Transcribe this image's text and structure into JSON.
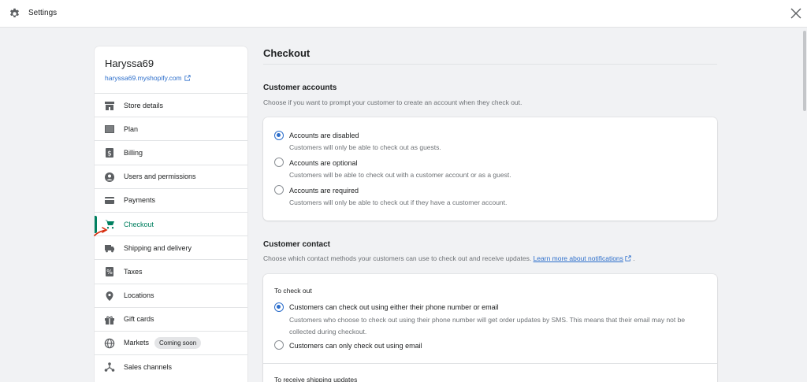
{
  "topbar": {
    "title": "Settings"
  },
  "sidebar": {
    "store_name": "Haryssa69",
    "store_url": "haryssa69.myshopify.com",
    "items": [
      {
        "label": "Store details",
        "icon": "store-icon"
      },
      {
        "label": "Plan",
        "icon": "plan-icon"
      },
      {
        "label": "Billing",
        "icon": "billing-icon"
      },
      {
        "label": "Users and permissions",
        "icon": "user-icon"
      },
      {
        "label": "Payments",
        "icon": "payments-icon"
      },
      {
        "label": "Checkout",
        "icon": "cart-icon",
        "active": true
      },
      {
        "label": "Shipping and delivery",
        "icon": "truck-icon"
      },
      {
        "label": "Taxes",
        "icon": "taxes-icon"
      },
      {
        "label": "Locations",
        "icon": "location-icon"
      },
      {
        "label": "Gift cards",
        "icon": "gift-icon"
      },
      {
        "label": "Markets",
        "icon": "globe-icon",
        "badge": "Coming soon"
      },
      {
        "label": "Sales channels",
        "icon": "channels-icon"
      }
    ]
  },
  "main": {
    "title": "Checkout",
    "customer_accounts": {
      "heading": "Customer accounts",
      "description": "Choose if you want to prompt your customer to create an account when they check out.",
      "options": [
        {
          "label": "Accounts are disabled",
          "help": "Customers will only be able to check out as guests.",
          "checked": true
        },
        {
          "label": "Accounts are optional",
          "help": "Customers will be able to check out with a customer account or as a guest.",
          "checked": false
        },
        {
          "label": "Accounts are required",
          "help": "Customers will only be able to check out if they have a customer account.",
          "checked": false
        }
      ]
    },
    "customer_contact": {
      "heading": "Customer contact",
      "description": "Choose which contact methods your customers can use to check out and receive updates.",
      "link": "Learn more about notifications",
      "desc_end": ".",
      "to_check_out": {
        "heading": "To check out",
        "options": [
          {
            "label": "Customers can check out using either their phone number or email",
            "help": "Customers who choose to check out using their phone number will get order updates by SMS. This means that their email may not be collected during checkout.",
            "checked": true
          },
          {
            "label": "Customers can only check out using email",
            "help": "",
            "checked": false
          }
        ]
      },
      "shipping_updates_heading": "To receive shipping updates"
    }
  },
  "colors": {
    "accent": "#2c6ecb",
    "active_green": "#008060",
    "annotation_red": "#d72c0d"
  }
}
